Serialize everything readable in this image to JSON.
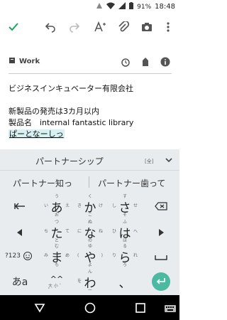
{
  "status_bar": {
    "battery": "91%",
    "time": "18:48"
  },
  "note": {
    "label": "Work",
    "line1": "ビジネスインキュベーター有限会社",
    "line2": "新製品の発売は3カ月以内",
    "line3": "製品名　internal fantastic library",
    "composing": "ぱーとなーしっ"
  },
  "keyboard": {
    "main_candidate": "パートナーシップ",
    "zen_label": "[全]",
    "candidates": [
      "パートナー知っ",
      "パートナー歯って"
    ],
    "sym_label": "?123",
    "ime_label": "あa",
    "keys": [
      {
        "main": "あ",
        "t": "う",
        "b": "お",
        "l": "い",
        "r": "え"
      },
      {
        "main": "か",
        "t": "く",
        "b": "こ",
        "l": "き",
        "r": "け"
      },
      {
        "main": "さ",
        "t": "す",
        "b": "そ",
        "l": "し",
        "r": "せ"
      },
      {
        "main": "た",
        "t": "つ",
        "b": "と",
        "l": "ち",
        "r": "て"
      },
      {
        "main": "な",
        "t": "ぬ",
        "b": "の",
        "l": "に",
        "r": "ね"
      },
      {
        "main": "は",
        "t": "ふ",
        "b": "ほ",
        "l": "ひ",
        "r": "へ"
      },
      {
        "main": "ま",
        "t": "む",
        "b": "も",
        "l": "み",
        "r": "め"
      },
      {
        "main": "や",
        "t": "ゆ",
        "b": "よ",
        "l": "(",
        "r": ")"
      },
      {
        "main": "ら",
        "t": "る",
        "b": "ろ",
        "l": "り",
        "r": "れ"
      },
      {
        "main": "^^",
        "t": "",
        "b": "",
        "l": "",
        "r": ""
      },
      {
        "main": "わ",
        "t": "ん",
        "b": "ー",
        "l": "を",
        "r": ""
      },
      {
        "main": "、",
        "t": "",
        "b": "",
        "l": "",
        "r": ""
      }
    ],
    "small_label": "大 小 ゛ ゜"
  },
  "colors": {
    "accent": "#1fa463",
    "enter": "#4cb9a3",
    "composing_bg": "#d7f1f2"
  }
}
